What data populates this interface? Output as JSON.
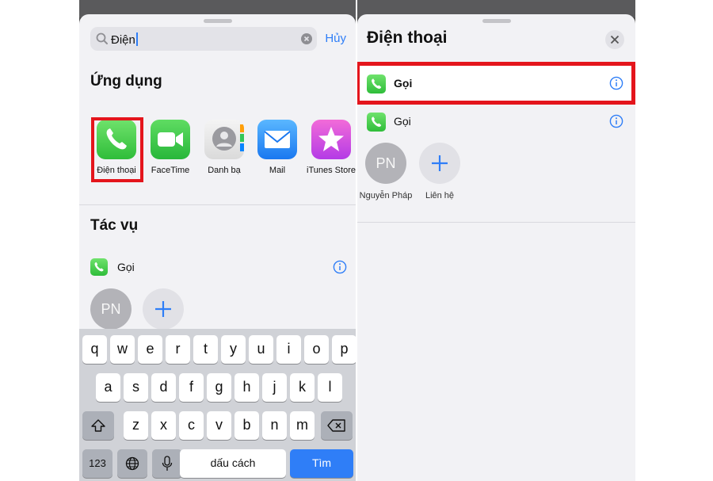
{
  "left": {
    "search": {
      "value": "Điện",
      "cancel_label": "Hủy"
    },
    "apps_section_title": "Ứng dụng",
    "apps": [
      {
        "label": "Điện thoại",
        "icon": "phone-icon"
      },
      {
        "label": "FaceTime",
        "icon": "facetime-icon"
      },
      {
        "label": "Danh bạ",
        "icon": "contacts-icon"
      },
      {
        "label": "Mail",
        "icon": "mail-icon"
      },
      {
        "label": "iTunes Store",
        "icon": "itunes-star-icon"
      }
    ],
    "actions_section_title": "Tác vụ",
    "action_row": {
      "label": "Gọi",
      "icon": "phone-icon"
    },
    "contacts": [
      {
        "initials": "PN"
      }
    ],
    "keyboard": {
      "row1": [
        "q",
        "w",
        "e",
        "r",
        "t",
        "y",
        "u",
        "i",
        "o",
        "p"
      ],
      "row2": [
        "a",
        "s",
        "d",
        "f",
        "g",
        "h",
        "j",
        "k",
        "l"
      ],
      "row3": [
        "z",
        "x",
        "c",
        "v",
        "b",
        "n",
        "m"
      ],
      "numbers_label": "123",
      "space_label": "dấu cách",
      "go_label": "Tìm"
    }
  },
  "right": {
    "title": "Điện thoại",
    "rows": [
      {
        "label": "Gọi",
        "icon": "phone-icon",
        "highlighted": true
      },
      {
        "label": "Gọi",
        "icon": "phone-icon",
        "highlighted": false
      }
    ],
    "contacts": [
      {
        "initials": "PN",
        "name": "Nguyễn Pháp"
      },
      {
        "name": "Liên hệ",
        "icon": "plus-icon"
      }
    ]
  },
  "colors": {
    "accent": "#2f7ef7",
    "highlight": "#e4151c",
    "phone_green": "#34c759"
  }
}
